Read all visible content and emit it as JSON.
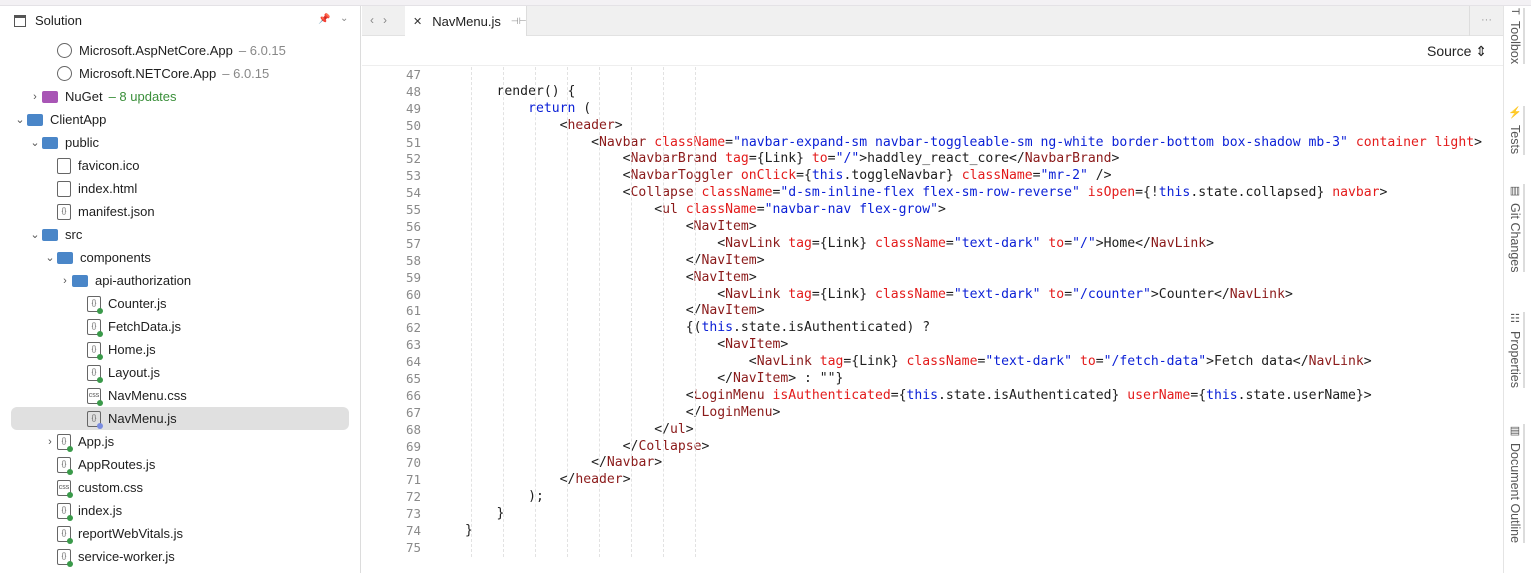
{
  "solution": {
    "title": "Solution",
    "items": [
      {
        "label": "Microsoft.AspNetCore.App",
        "sub": "– 6.0.15",
        "depth": 3,
        "icon": "package-icon",
        "chevron": ""
      },
      {
        "label": "Microsoft.NETCore.App",
        "sub": "– 6.0.15",
        "depth": 3,
        "icon": "package-icon",
        "chevron": ""
      },
      {
        "label": "NuGet",
        "upd": "– 8 updates",
        "depth": 2,
        "icon": "nuget-icon",
        "chevron": "›"
      },
      {
        "label": "ClientApp",
        "depth": 1,
        "icon": "folder-icon",
        "chevron": "⌄"
      },
      {
        "label": "public",
        "depth": 2,
        "icon": "folder-icon",
        "chevron": "⌄"
      },
      {
        "label": "favicon.ico",
        "depth": 3,
        "icon": "file-icon",
        "chevron": ""
      },
      {
        "label": "index.html",
        "depth": 3,
        "icon": "html-file-icon",
        "chevron": ""
      },
      {
        "label": "manifest.json",
        "depth": 3,
        "icon": "json-file-icon",
        "chevron": ""
      },
      {
        "label": "src",
        "depth": 2,
        "icon": "folder-icon",
        "chevron": "⌄"
      },
      {
        "label": "components",
        "depth": 3,
        "icon": "folder-icon",
        "chevron": "⌄"
      },
      {
        "label": "api-authorization",
        "depth": 4,
        "icon": "folder-icon",
        "chevron": "›"
      },
      {
        "label": "Counter.js",
        "depth": 5,
        "icon": "js-file-icon",
        "chevron": ""
      },
      {
        "label": "FetchData.js",
        "depth": 5,
        "icon": "js-file-icon",
        "chevron": ""
      },
      {
        "label": "Home.js",
        "depth": 5,
        "icon": "js-file-icon",
        "chevron": ""
      },
      {
        "label": "Layout.js",
        "depth": 5,
        "icon": "js-file-icon",
        "chevron": ""
      },
      {
        "label": "NavMenu.css",
        "depth": 5,
        "icon": "css-file-icon",
        "chevron": ""
      },
      {
        "label": "NavMenu.js",
        "depth": 5,
        "icon": "js-file-icon",
        "chevron": "",
        "selected": true
      },
      {
        "label": "App.js",
        "depth": 3,
        "icon": "js-file-icon",
        "chevron": "›"
      },
      {
        "label": "AppRoutes.js",
        "depth": 3,
        "icon": "js-file-icon",
        "chevron": ""
      },
      {
        "label": "custom.css",
        "depth": 3,
        "icon": "css-file-icon",
        "chevron": ""
      },
      {
        "label": "index.js",
        "depth": 3,
        "icon": "js-file-icon",
        "chevron": ""
      },
      {
        "label": "reportWebVitals.js",
        "depth": 3,
        "icon": "js-file-icon",
        "chevron": ""
      },
      {
        "label": "service-worker.js",
        "depth": 3,
        "icon": "js-file-icon",
        "chevron": ""
      }
    ]
  },
  "editor": {
    "tab": "NavMenu.js",
    "view_mode": "Source",
    "lines": [
      {
        "n": "47",
        "t": []
      },
      {
        "n": "48",
        "t": [
          [
            "p",
            "    render() {"
          ]
        ]
      },
      {
        "n": "49",
        "t": [
          [
            "k",
            "        return"
          ],
          [
            "p",
            " ("
          ]
        ]
      },
      {
        "n": "50",
        "t": [
          [
            "p",
            "            <"
          ],
          [
            "t",
            "header"
          ],
          [
            "p",
            ">"
          ]
        ]
      },
      {
        "n": "51",
        "t": [
          [
            "p",
            "                <"
          ],
          [
            "t",
            "Navbar"
          ],
          [
            "a",
            " className"
          ],
          [
            "p",
            "="
          ],
          [
            "s",
            "\"navbar-expand-sm navbar-toggleable-sm ng-white border-bottom box-shadow mb-3\""
          ],
          [
            "a",
            " container light"
          ],
          [
            "p",
            ">"
          ]
        ]
      },
      {
        "n": "52",
        "t": [
          [
            "p",
            "                    <"
          ],
          [
            "t",
            "NavbarBrand"
          ],
          [
            "a",
            " tag"
          ],
          [
            "p",
            "={Link} "
          ],
          [
            "a",
            "to"
          ],
          [
            "p",
            "="
          ],
          [
            "s",
            "\"/\""
          ],
          [
            "p",
            ">haddley_react_core</"
          ],
          [
            "t",
            "NavbarBrand"
          ],
          [
            "p",
            ">"
          ]
        ]
      },
      {
        "n": "53",
        "t": [
          [
            "p",
            "                    <"
          ],
          [
            "t",
            "NavbarToggler"
          ],
          [
            "a",
            " onClick"
          ],
          [
            "p",
            "={"
          ],
          [
            "k",
            "this"
          ],
          [
            "p",
            ".toggleNavbar} "
          ],
          [
            "a",
            "className"
          ],
          [
            "p",
            "="
          ],
          [
            "s",
            "\"mr-2\""
          ],
          [
            "p",
            " />"
          ]
        ]
      },
      {
        "n": "54",
        "t": [
          [
            "p",
            "                    <"
          ],
          [
            "t",
            "Collapse"
          ],
          [
            "a",
            " className"
          ],
          [
            "p",
            "="
          ],
          [
            "s",
            "\"d-sm-inline-flex flex-sm-row-reverse\""
          ],
          [
            "a",
            " isOpen"
          ],
          [
            "p",
            "={!"
          ],
          [
            "k",
            "this"
          ],
          [
            "p",
            ".state.collapsed} "
          ],
          [
            "a",
            "navbar"
          ],
          [
            "p",
            ">"
          ]
        ]
      },
      {
        "n": "55",
        "t": [
          [
            "p",
            "                        <"
          ],
          [
            "t",
            "ul"
          ],
          [
            "a",
            " className"
          ],
          [
            "p",
            "="
          ],
          [
            "s",
            "\"navbar-nav flex-grow\""
          ],
          [
            "p",
            ">"
          ]
        ]
      },
      {
        "n": "56",
        "t": [
          [
            "p",
            "                            <"
          ],
          [
            "t",
            "NavItem"
          ],
          [
            "p",
            ">"
          ]
        ]
      },
      {
        "n": "57",
        "t": [
          [
            "p",
            "                                <"
          ],
          [
            "t",
            "NavLink"
          ],
          [
            "a",
            " tag"
          ],
          [
            "p",
            "={Link} "
          ],
          [
            "a",
            "className"
          ],
          [
            "p",
            "="
          ],
          [
            "s",
            "\"text-dark\""
          ],
          [
            "a",
            " to"
          ],
          [
            "p",
            "="
          ],
          [
            "s",
            "\"/\""
          ],
          [
            "p",
            ">Home</"
          ],
          [
            "t",
            "NavLink"
          ],
          [
            "p",
            ">"
          ]
        ]
      },
      {
        "n": "58",
        "t": [
          [
            "p",
            "                            </"
          ],
          [
            "t",
            "NavItem"
          ],
          [
            "p",
            ">"
          ]
        ]
      },
      {
        "n": "59",
        "t": [
          [
            "p",
            "                            <"
          ],
          [
            "t",
            "NavItem"
          ],
          [
            "p",
            ">"
          ]
        ]
      },
      {
        "n": "60",
        "t": [
          [
            "p",
            "                                <"
          ],
          [
            "t",
            "NavLink"
          ],
          [
            "a",
            " tag"
          ],
          [
            "p",
            "={Link} "
          ],
          [
            "a",
            "className"
          ],
          [
            "p",
            "="
          ],
          [
            "s",
            "\"text-dark\""
          ],
          [
            "a",
            " to"
          ],
          [
            "p",
            "="
          ],
          [
            "s",
            "\"/counter\""
          ],
          [
            "p",
            ">Counter</"
          ],
          [
            "t",
            "NavLink"
          ],
          [
            "p",
            ">"
          ]
        ]
      },
      {
        "n": "61",
        "t": [
          [
            "p",
            "                            </"
          ],
          [
            "t",
            "NavItem"
          ],
          [
            "p",
            ">"
          ]
        ]
      },
      {
        "n": "62",
        "t": [
          [
            "p",
            "                            {("
          ],
          [
            "k",
            "this"
          ],
          [
            "p",
            ".state.isAuthenticated) ?"
          ]
        ]
      },
      {
        "n": "63",
        "t": [
          [
            "p",
            "                                <"
          ],
          [
            "t",
            "NavItem"
          ],
          [
            "p",
            ">"
          ]
        ]
      },
      {
        "n": "64",
        "t": [
          [
            "p",
            "                                    <"
          ],
          [
            "t",
            "NavLink"
          ],
          [
            "a",
            " tag"
          ],
          [
            "p",
            "={Link} "
          ],
          [
            "a",
            "className"
          ],
          [
            "p",
            "="
          ],
          [
            "s",
            "\"text-dark\""
          ],
          [
            "a",
            " to"
          ],
          [
            "p",
            "="
          ],
          [
            "s",
            "\"/fetch-data\""
          ],
          [
            "p",
            ">Fetch data</"
          ],
          [
            "t",
            "NavLink"
          ],
          [
            "p",
            ">"
          ]
        ]
      },
      {
        "n": "65",
        "t": [
          [
            "p",
            "                                </"
          ],
          [
            "t",
            "NavItem"
          ],
          [
            "p",
            "> : \"\"}"
          ]
        ]
      },
      {
        "n": "66",
        "t": [
          [
            "p",
            "                            <"
          ],
          [
            "t",
            "LoginMenu"
          ],
          [
            "a",
            " isAuthenticated"
          ],
          [
            "p",
            "={"
          ],
          [
            "k",
            "this"
          ],
          [
            "p",
            ".state.isAuthenticated} "
          ],
          [
            "a",
            "userName"
          ],
          [
            "p",
            "={"
          ],
          [
            "k",
            "this"
          ],
          [
            "p",
            ".state.userName}>"
          ]
        ]
      },
      {
        "n": "67",
        "t": [
          [
            "p",
            "                            </"
          ],
          [
            "t",
            "LoginMenu"
          ],
          [
            "p",
            ">"
          ]
        ]
      },
      {
        "n": "68",
        "t": [
          [
            "p",
            "                        </"
          ],
          [
            "t",
            "ul"
          ],
          [
            "p",
            ">"
          ]
        ]
      },
      {
        "n": "69",
        "t": [
          [
            "p",
            "                    </"
          ],
          [
            "t",
            "Collapse"
          ],
          [
            "p",
            ">"
          ]
        ]
      },
      {
        "n": "70",
        "t": [
          [
            "p",
            "                </"
          ],
          [
            "t",
            "Navbar"
          ],
          [
            "p",
            ">"
          ]
        ]
      },
      {
        "n": "71",
        "t": [
          [
            "p",
            "            </"
          ],
          [
            "t",
            "header"
          ],
          [
            "p",
            ">"
          ]
        ]
      },
      {
        "n": "72",
        "t": [
          [
            "p",
            "        );"
          ]
        ]
      },
      {
        "n": "73",
        "t": [
          [
            "p",
            "    }"
          ]
        ]
      },
      {
        "n": "74",
        "t": [
          [
            "p",
            "}"
          ]
        ]
      },
      {
        "n": "75",
        "t": []
      }
    ]
  },
  "right_panels": [
    {
      "label": "Toolbox",
      "icon": "T"
    },
    {
      "label": "Tests",
      "icon": "⚡"
    },
    {
      "label": "Git Changes",
      "icon": "▥"
    },
    {
      "label": "Properties",
      "icon": "☷"
    },
    {
      "label": "Document Outline",
      "icon": "▤"
    }
  ]
}
